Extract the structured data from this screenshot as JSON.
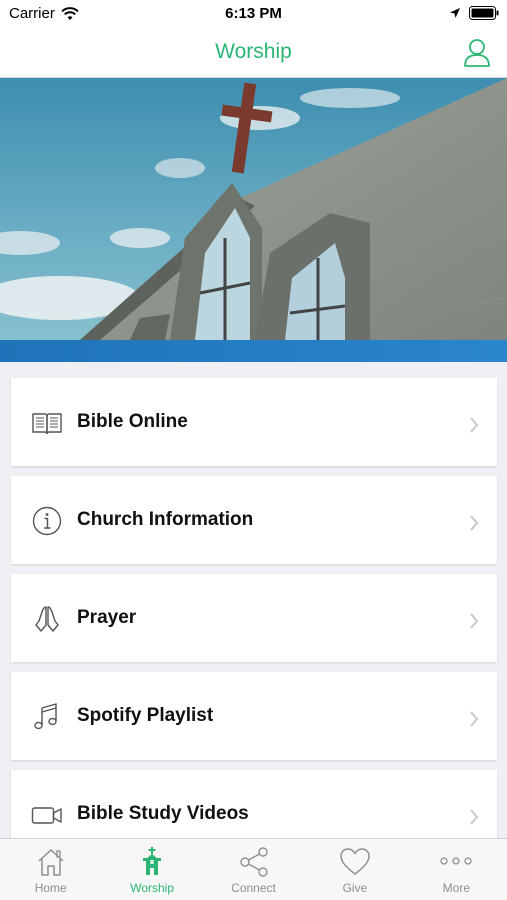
{
  "status_bar": {
    "carrier": "Carrier",
    "time": "6:13 PM"
  },
  "nav": {
    "title": "Worship",
    "accent_color": "#2bb673"
  },
  "menu": {
    "items": [
      {
        "label": "Bible Online",
        "icon": "open-book-icon"
      },
      {
        "label": "Church Information",
        "icon": "info-icon"
      },
      {
        "label": "Prayer",
        "icon": "praying-hands-icon"
      },
      {
        "label": "Spotify Playlist",
        "icon": "music-note-icon"
      },
      {
        "label": "Bible Study Videos",
        "icon": "video-camera-icon"
      }
    ]
  },
  "tab_bar": {
    "tabs": [
      {
        "label": "Home",
        "icon": "home-icon",
        "active": false
      },
      {
        "label": "Worship",
        "icon": "church-icon",
        "active": true
      },
      {
        "label": "Connect",
        "icon": "share-icon",
        "active": false
      },
      {
        "label": "Give",
        "icon": "heart-icon",
        "active": false
      },
      {
        "label": "More",
        "icon": "more-dots-icon",
        "active": false
      }
    ]
  }
}
